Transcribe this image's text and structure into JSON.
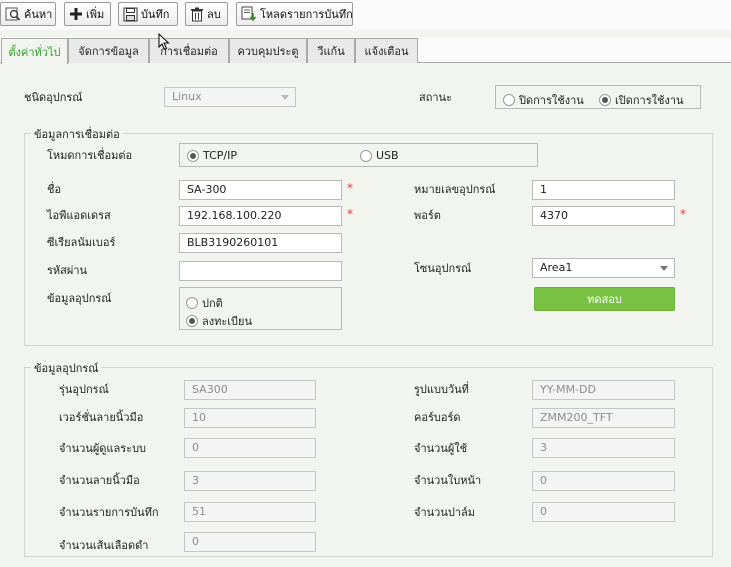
{
  "toolbar": {
    "search": "ค้นหา",
    "add": "เพิ่ม",
    "save": "บันทึก",
    "delete": "ลบ",
    "download_records": "โหลดรายการบันทึก"
  },
  "tabs": [
    {
      "label": "ตั้งค่าทั่วไป",
      "active": true
    },
    {
      "label": "จัดการข้อมูล"
    },
    {
      "label": "การเชื่อมต่อ"
    },
    {
      "label": "ควบคุมประตู"
    },
    {
      "label": "วีแก้น"
    },
    {
      "label": "แจ้งเตือน"
    }
  ],
  "general": {
    "device_type_label": "ชนิดอุปกรณ์",
    "device_type_value": "Linux",
    "status_label": "สถานะ",
    "status_options": [
      "ปิดการใช้งาน",
      "เปิดการใช้งาน"
    ],
    "status_selected": "เปิดการใช้งาน"
  },
  "connection": {
    "section_title": "ข้อมูลการเชื่อมต่อ",
    "mode_label": "โหมดการเชื่อมต่อ",
    "mode_options": [
      "TCP/IP",
      "USB"
    ],
    "mode_selected": "TCP/IP",
    "name_label": "ชื่อ",
    "name_value": "SA-300",
    "ip_label": "ไอพีแอดเดรส",
    "ip_value": "192.168.100.220",
    "serial_label": "ซีเรียลนัมเบอร์",
    "serial_value": "BLB3190260101",
    "password_label": "รหัสผ่าน",
    "password_value": "",
    "device_info_label": "ข้อมูลอุปกรณ์",
    "device_info_options": [
      "ปกติ",
      "ลงทะเบียน"
    ],
    "device_info_selected": "ลงทะเบียน",
    "device_number_label": "หมายเลขอุปกรณ์",
    "device_number_value": "1",
    "port_label": "พอร์ต",
    "port_value": "4370",
    "zone_label": "โซนอุปกรณ์",
    "zone_value": "Area1",
    "test_button": "ทดสอบ",
    "required_mark": "*"
  },
  "device_info": {
    "section_title": "ข้อมูลอุปกรณ์",
    "left": [
      {
        "label": "รุ่นอุปกรณ์",
        "value": "SA300"
      },
      {
        "label": "เวอร์ชั่นลายนิ้วมือ",
        "value": "10"
      },
      {
        "label": "จำนวนผู้ดูแลระบบ",
        "value": "0"
      },
      {
        "label": "จำนวนลายนิ้วมือ",
        "value": "3"
      },
      {
        "label": "จำนวนรายการบันทึก",
        "value": "51"
      },
      {
        "label": "จำนวนเส้นเลือดดำ",
        "value": "0"
      }
    ],
    "right": [
      {
        "label": "รูปแบบวันที่",
        "value": "YY-MM-DD"
      },
      {
        "label": "คอร์บอร์ด",
        "value": "ZMM200_TFT"
      },
      {
        "label": "จำนวนผู้ใช้",
        "value": "3"
      },
      {
        "label": "จำนวนใบหน้า",
        "value": "0"
      },
      {
        "label": "จำนวนปาล์ม",
        "value": "0"
      }
    ]
  }
}
